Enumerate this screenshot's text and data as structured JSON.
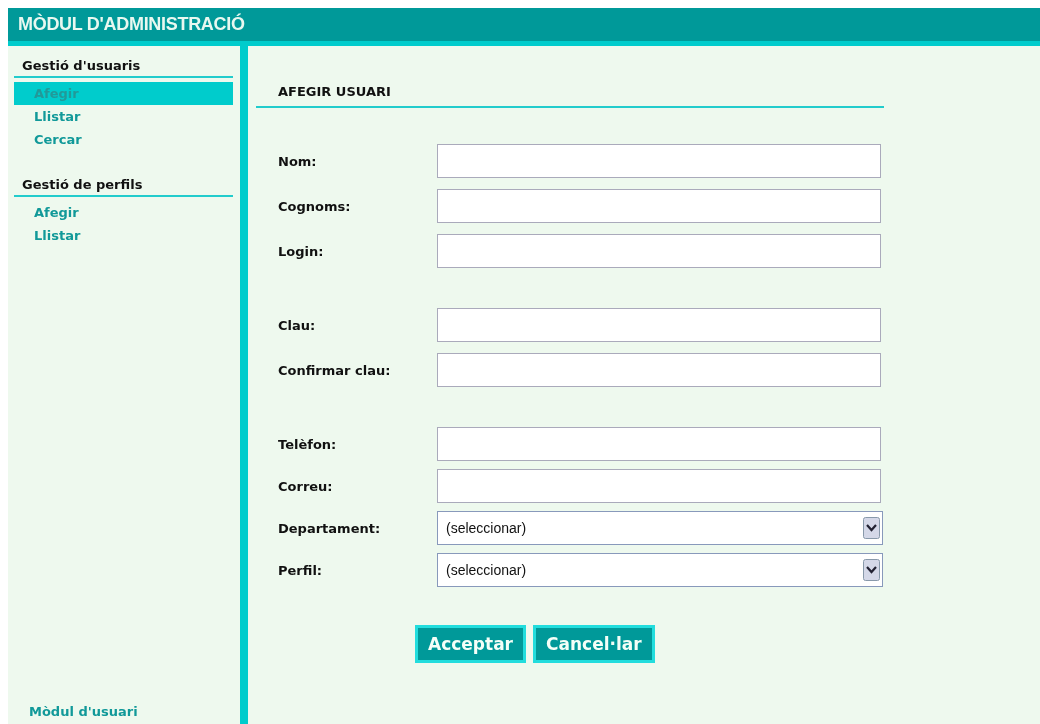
{
  "header": {
    "title": "MÒDUL D'ADMINISTRACIÓ"
  },
  "sidebar": {
    "sections": [
      {
        "heading": "Gestió d'usuaris",
        "items": [
          {
            "label": "Afegir",
            "selected": true
          },
          {
            "label": "Llistar",
            "selected": false
          },
          {
            "label": "Cercar",
            "selected": false
          }
        ]
      },
      {
        "heading": "Gestió de perfils",
        "items": [
          {
            "label": "Afegir",
            "selected": false
          },
          {
            "label": "Llistar",
            "selected": false
          }
        ]
      }
    ],
    "footer_link": "Mòdul d'usuari"
  },
  "form": {
    "title": "AFEGIR USUARI",
    "groups": [
      [
        {
          "label": "Nom:",
          "kind": "text"
        },
        {
          "label": "Cognoms:",
          "kind": "text"
        },
        {
          "label": "Login:",
          "kind": "text"
        }
      ],
      [
        {
          "label": "Clau:",
          "kind": "text"
        },
        {
          "label": "Confirmar clau:",
          "kind": "text"
        }
      ],
      [
        {
          "label": "Telèfon:",
          "kind": "text"
        },
        {
          "label": "Correu:",
          "kind": "text"
        },
        {
          "label": "Departament:",
          "kind": "select",
          "value": "(seleccionar)"
        },
        {
          "label": "Perfil:",
          "kind": "select",
          "value": "(seleccionar)"
        }
      ]
    ],
    "buttons": [
      "Acceptar",
      "Cancel·lar"
    ]
  }
}
